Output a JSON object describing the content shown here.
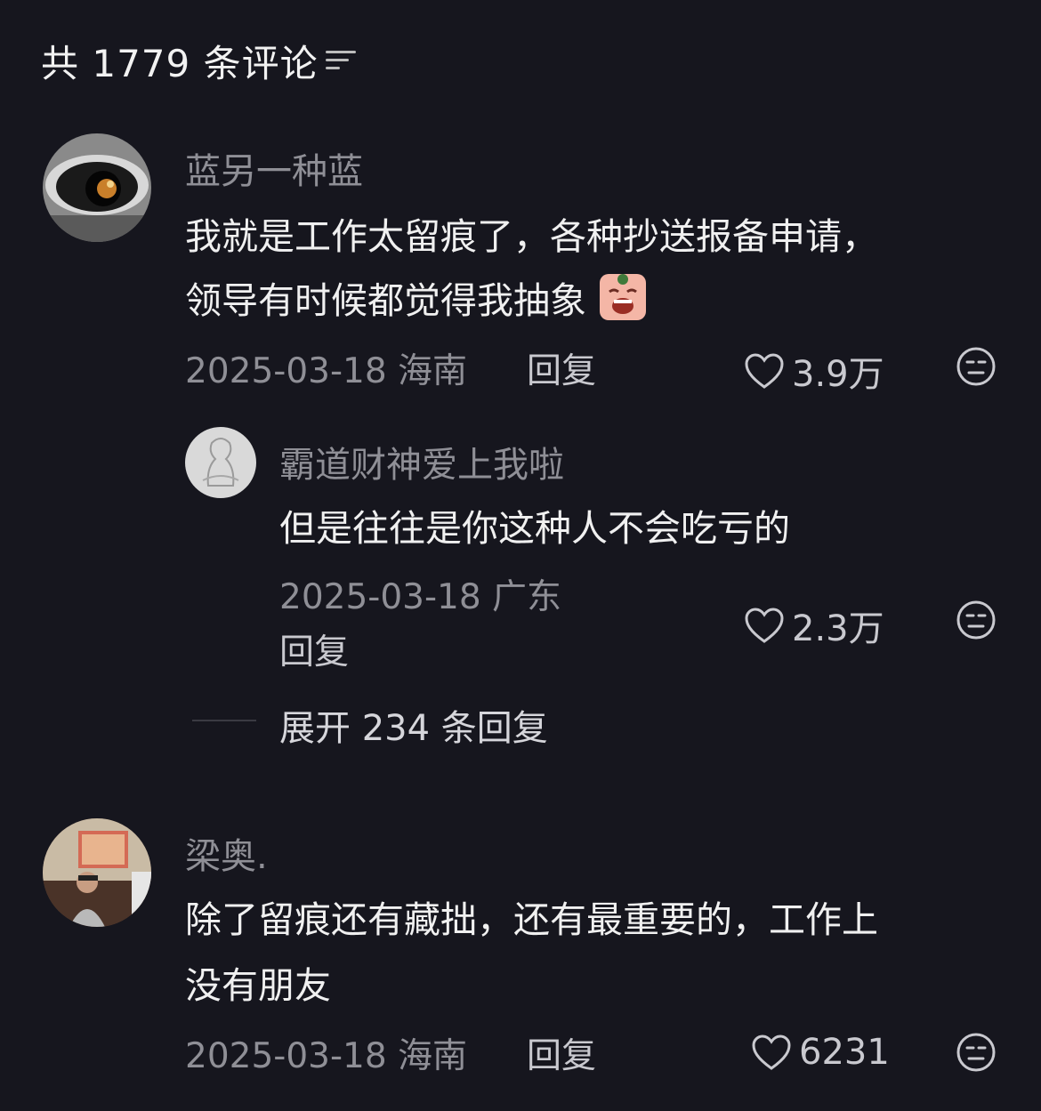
{
  "header": {
    "title": "共 1779 条评论",
    "filter_icon": "filter-icon"
  },
  "comments": [
    {
      "username": "蓝另一种蓝",
      "text_lines": [
        "我就是工作太留痕了，各种抄送报备申请，",
        "领导有时候都觉得我抽象"
      ],
      "emoji": "crying-face-emoji",
      "date_location": "2025-03-18 海南",
      "reply_label": "回复",
      "likes": "3.9万",
      "dislike_icon": "dislike-face-icon",
      "replies": [
        {
          "username": "霸道财神爱上我啦",
          "text": "但是往往是你这种人不会吃亏的",
          "date_location": "2025-03-18 广东",
          "reply_label": "回复",
          "likes": "2.3万"
        }
      ],
      "expand_label": "展开 234 条回复"
    },
    {
      "username": "梁奥.",
      "text_lines": [
        "除了留痕还有藏拙，还有最重要的，工作上",
        "没有朋友"
      ],
      "date_location": "2025-03-18 海南",
      "reply_label": "回复",
      "likes": "6231"
    }
  ],
  "colors": {
    "background": "#16161e",
    "muted": "#8f8f96",
    "text": "#f0f0f0"
  }
}
